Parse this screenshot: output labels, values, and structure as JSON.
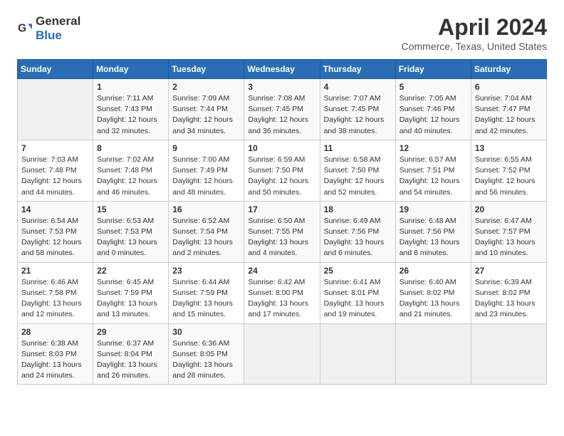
{
  "header": {
    "logo_general": "General",
    "logo_blue": "Blue",
    "title": "April 2024",
    "subtitle": "Commerce, Texas, United States"
  },
  "calendar": {
    "days_of_week": [
      "Sunday",
      "Monday",
      "Tuesday",
      "Wednesday",
      "Thursday",
      "Friday",
      "Saturday"
    ],
    "weeks": [
      [
        {
          "num": "",
          "info": ""
        },
        {
          "num": "1",
          "info": "Sunrise: 7:11 AM\nSunset: 7:43 PM\nDaylight: 12 hours\nand 32 minutes."
        },
        {
          "num": "2",
          "info": "Sunrise: 7:09 AM\nSunset: 7:44 PM\nDaylight: 12 hours\nand 34 minutes."
        },
        {
          "num": "3",
          "info": "Sunrise: 7:08 AM\nSunset: 7:45 PM\nDaylight: 12 hours\nand 36 minutes."
        },
        {
          "num": "4",
          "info": "Sunrise: 7:07 AM\nSunset: 7:45 PM\nDaylight: 12 hours\nand 38 minutes."
        },
        {
          "num": "5",
          "info": "Sunrise: 7:05 AM\nSunset: 7:46 PM\nDaylight: 12 hours\nand 40 minutes."
        },
        {
          "num": "6",
          "info": "Sunrise: 7:04 AM\nSunset: 7:47 PM\nDaylight: 12 hours\nand 42 minutes."
        }
      ],
      [
        {
          "num": "7",
          "info": "Sunrise: 7:03 AM\nSunset: 7:48 PM\nDaylight: 12 hours\nand 44 minutes."
        },
        {
          "num": "8",
          "info": "Sunrise: 7:02 AM\nSunset: 7:48 PM\nDaylight: 12 hours\nand 46 minutes."
        },
        {
          "num": "9",
          "info": "Sunrise: 7:00 AM\nSunset: 7:49 PM\nDaylight: 12 hours\nand 48 minutes."
        },
        {
          "num": "10",
          "info": "Sunrise: 6:59 AM\nSunset: 7:50 PM\nDaylight: 12 hours\nand 50 minutes."
        },
        {
          "num": "11",
          "info": "Sunrise: 6:58 AM\nSunset: 7:50 PM\nDaylight: 12 hours\nand 52 minutes."
        },
        {
          "num": "12",
          "info": "Sunrise: 6:57 AM\nSunset: 7:51 PM\nDaylight: 12 hours\nand 54 minutes."
        },
        {
          "num": "13",
          "info": "Sunrise: 6:55 AM\nSunset: 7:52 PM\nDaylight: 12 hours\nand 56 minutes."
        }
      ],
      [
        {
          "num": "14",
          "info": "Sunrise: 6:54 AM\nSunset: 7:53 PM\nDaylight: 12 hours\nand 58 minutes."
        },
        {
          "num": "15",
          "info": "Sunrise: 6:53 AM\nSunset: 7:53 PM\nDaylight: 13 hours\nand 0 minutes."
        },
        {
          "num": "16",
          "info": "Sunrise: 6:52 AM\nSunset: 7:54 PM\nDaylight: 13 hours\nand 2 minutes."
        },
        {
          "num": "17",
          "info": "Sunrise: 6:50 AM\nSunset: 7:55 PM\nDaylight: 13 hours\nand 4 minutes."
        },
        {
          "num": "18",
          "info": "Sunrise: 6:49 AM\nSunset: 7:56 PM\nDaylight: 13 hours\nand 6 minutes."
        },
        {
          "num": "19",
          "info": "Sunrise: 6:48 AM\nSunset: 7:56 PM\nDaylight: 13 hours\nand 8 minutes."
        },
        {
          "num": "20",
          "info": "Sunrise: 6:47 AM\nSunset: 7:57 PM\nDaylight: 13 hours\nand 10 minutes."
        }
      ],
      [
        {
          "num": "21",
          "info": "Sunrise: 6:46 AM\nSunset: 7:58 PM\nDaylight: 13 hours\nand 12 minutes."
        },
        {
          "num": "22",
          "info": "Sunrise: 6:45 AM\nSunset: 7:59 PM\nDaylight: 13 hours\nand 13 minutes."
        },
        {
          "num": "23",
          "info": "Sunrise: 6:44 AM\nSunset: 7:59 PM\nDaylight: 13 hours\nand 15 minutes."
        },
        {
          "num": "24",
          "info": "Sunrise: 6:42 AM\nSunset: 8:00 PM\nDaylight: 13 hours\nand 17 minutes."
        },
        {
          "num": "25",
          "info": "Sunrise: 6:41 AM\nSunset: 8:01 PM\nDaylight: 13 hours\nand 19 minutes."
        },
        {
          "num": "26",
          "info": "Sunrise: 6:40 AM\nSunset: 8:02 PM\nDaylight: 13 hours\nand 21 minutes."
        },
        {
          "num": "27",
          "info": "Sunrise: 6:39 AM\nSunset: 8:02 PM\nDaylight: 13 hours\nand 23 minutes."
        }
      ],
      [
        {
          "num": "28",
          "info": "Sunrise: 6:38 AM\nSunset: 8:03 PM\nDaylight: 13 hours\nand 24 minutes."
        },
        {
          "num": "29",
          "info": "Sunrise: 6:37 AM\nSunset: 8:04 PM\nDaylight: 13 hours\nand 26 minutes."
        },
        {
          "num": "30",
          "info": "Sunrise: 6:36 AM\nSunset: 8:05 PM\nDaylight: 13 hours\nand 28 minutes."
        },
        {
          "num": "",
          "info": ""
        },
        {
          "num": "",
          "info": ""
        },
        {
          "num": "",
          "info": ""
        },
        {
          "num": "",
          "info": ""
        }
      ]
    ]
  }
}
